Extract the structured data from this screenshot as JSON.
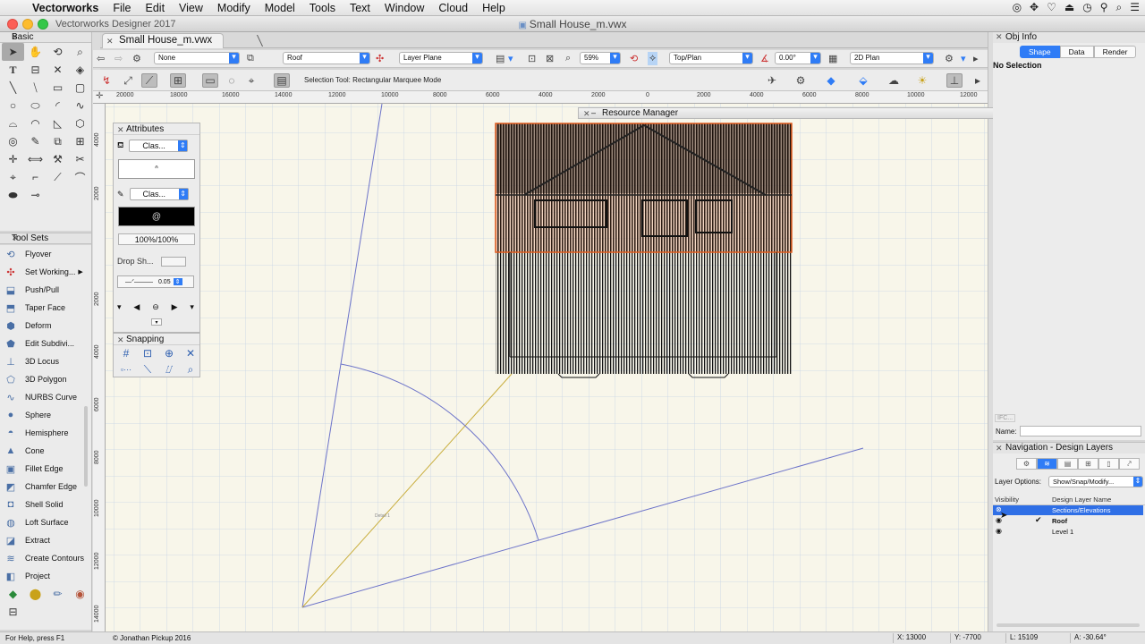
{
  "menubar": {
    "app_name": "Vectorworks",
    "items": [
      "File",
      "Edit",
      "View",
      "Modify",
      "Model",
      "Tools",
      "Text",
      "Window",
      "Cloud",
      "Help"
    ],
    "status_icons": [
      "cc-icon",
      "dropbox-icon",
      "heart-icon",
      "upload-icon",
      "clock-icon",
      "user-icon",
      "spotlight-icon",
      "list-icon"
    ]
  },
  "titlebar": {
    "app_title": "Vectorworks Designer 2017",
    "document_title": "Small House_m.vwx"
  },
  "left": {
    "basic_title": "Basic",
    "toolsets_title": "Tool Sets",
    "toolsets": [
      {
        "label": "Flyover",
        "icon": "flyover-icon"
      },
      {
        "label": "Set Working...",
        "icon": "working-plane-icon",
        "submenu": true
      },
      {
        "label": "Push/Pull",
        "icon": "push-pull-icon"
      },
      {
        "label": "Taper Face",
        "icon": "taper-face-icon"
      },
      {
        "label": "Deform",
        "icon": "deform-icon"
      },
      {
        "label": "Edit Subdivi...",
        "icon": "subdivision-icon"
      },
      {
        "label": "3D Locus",
        "icon": "locus-icon"
      },
      {
        "label": "3D Polygon",
        "icon": "polygon-3d-icon"
      },
      {
        "label": "NURBS Curve",
        "icon": "nurbs-icon"
      },
      {
        "label": "Sphere",
        "icon": "sphere-icon"
      },
      {
        "label": "Hemisphere",
        "icon": "hemisphere-icon"
      },
      {
        "label": "Cone",
        "icon": "cone-icon"
      },
      {
        "label": "Fillet Edge",
        "icon": "fillet-icon"
      },
      {
        "label": "Chamfer Edge",
        "icon": "chamfer-icon"
      },
      {
        "label": "Shell Solid",
        "icon": "shell-icon"
      },
      {
        "label": "Loft Surface",
        "icon": "loft-icon"
      },
      {
        "label": "Extract",
        "icon": "extract-icon"
      },
      {
        "label": "Create Contours",
        "icon": "contours-icon"
      },
      {
        "label": "Project",
        "icon": "project-icon"
      }
    ]
  },
  "doc_tab": {
    "label": "Small House_m.vwx"
  },
  "viewbar": {
    "class_value": "None",
    "layer_value": "Roof",
    "plane_value": "Layer Plane",
    "zoom_value": "59%",
    "view_value": "Top/Plan",
    "angle_value": "0.00°",
    "render_value": "2D Plan"
  },
  "modebar": {
    "mode_label": "Selection Tool: Rectangular Marquee Mode"
  },
  "rulers": {
    "top_labels": [
      "20000",
      "18000",
      "16000",
      "14000",
      "12000",
      "10000",
      "8000",
      "6000",
      "4000",
      "2000",
      "0",
      "2000",
      "4000",
      "6000",
      "8000",
      "10000",
      "12000"
    ],
    "left_labels": [
      "4000",
      "2000",
      "2000",
      "4000",
      "6000",
      "8000",
      "10000",
      "12000",
      "14000"
    ]
  },
  "canvas": {
    "dim_text": "Detail 1"
  },
  "attributes": {
    "title": "Attributes",
    "fill_class": "Clas...",
    "pen_class": "Clas...",
    "opacity": "100%/100%",
    "drop_shadow": "Drop Sh...",
    "line_weight": "0.05"
  },
  "snapping": {
    "title": "Snapping"
  },
  "resource_manager": {
    "title": "Resource Manager"
  },
  "obj_info": {
    "title": "Obj Info",
    "tabs": [
      "Shape",
      "Data",
      "Render"
    ],
    "selection_text": "No Selection",
    "ifc_label": "IFC...",
    "name_label": "Name:"
  },
  "navigation": {
    "title": "Navigation - Design Layers",
    "layer_options_label": "Layer Options:",
    "layer_options_value": "Show/Snap/Modify...",
    "col_visibility": "Visibility",
    "col_name": "Design Layer Name",
    "layers": [
      {
        "name": "Sections/Elevations",
        "selected": true,
        "active": false
      },
      {
        "name": "Roof",
        "selected": false,
        "active": true
      },
      {
        "name": "Level 1",
        "selected": false,
        "active": false
      }
    ]
  },
  "status": {
    "help": "For Help, press F1",
    "credit": "© Jonathan Pickup 2016",
    "x": "X: 13000",
    "y": "Y: -7700",
    "l": "L: 15109",
    "a": "A: -30.64°"
  }
}
